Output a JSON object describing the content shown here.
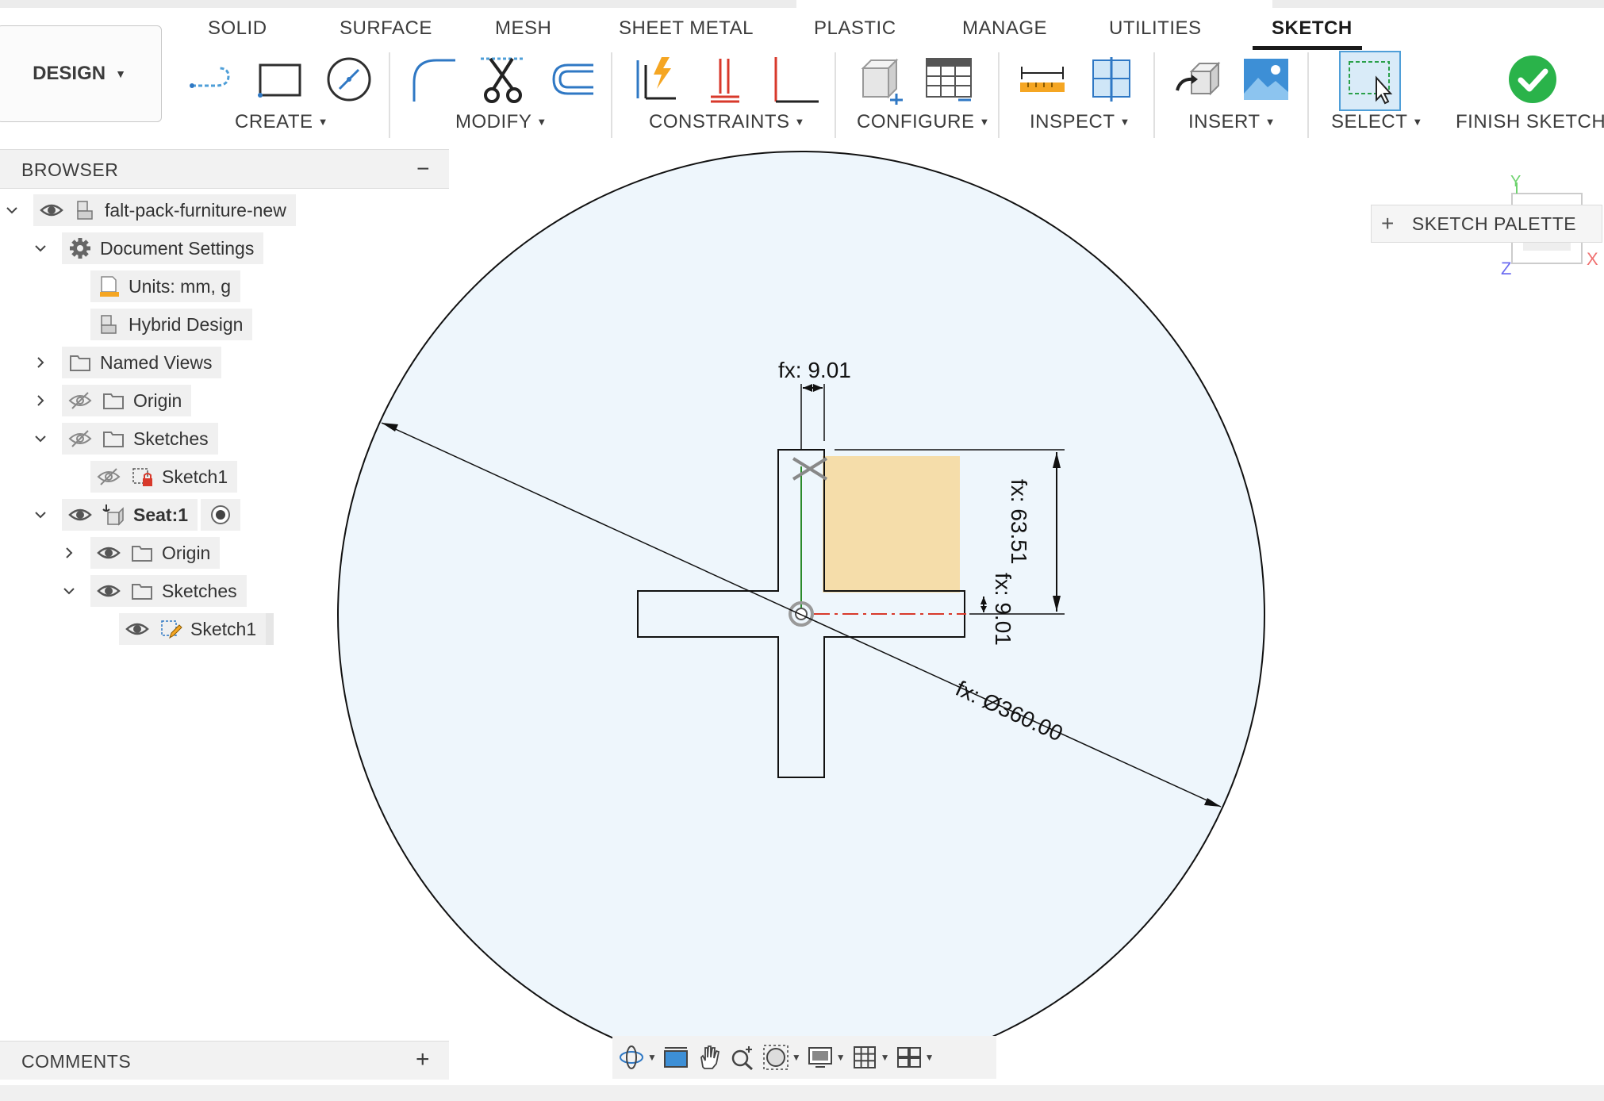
{
  "tabs": [
    "SOLID",
    "SURFACE",
    "MESH",
    "SHEET METAL",
    "PLASTIC",
    "MANAGE",
    "UTILITIES",
    "SKETCH"
  ],
  "active_tab": "SKETCH",
  "workspace": {
    "label": "DESIGN"
  },
  "groups": {
    "create": "CREATE",
    "modify": "MODIFY",
    "constraints": "CONSTRAINTS",
    "configure": "CONFIGURE",
    "inspect": "INSPECT",
    "insert": "INSERT",
    "select": "SELECT",
    "finish": "FINISH SKETCH"
  },
  "browser": {
    "title": "BROWSER",
    "collapse_symbol": "−",
    "items": [
      {
        "label": "falt-pack-furniture-new",
        "icon": "component-icon"
      },
      {
        "label": "Document Settings",
        "icon": "gear-icon"
      },
      {
        "label": "Units: mm, g",
        "icon": "ruler-doc-icon"
      },
      {
        "label": "Hybrid Design",
        "icon": "component-icon"
      },
      {
        "label": "Named Views",
        "icon": "folder-icon"
      },
      {
        "label": "Origin",
        "icon": "folder-icon"
      },
      {
        "label": "Sketches",
        "icon": "folder-icon"
      },
      {
        "label": "Sketch1",
        "icon": "sketch-locked-icon"
      },
      {
        "label": "Seat:1",
        "icon": "anchored-component-icon"
      },
      {
        "label": "Origin",
        "icon": "folder-icon"
      },
      {
        "label": "Sketches",
        "icon": "folder-icon"
      },
      {
        "label": "Sketch1",
        "icon": "sketch-edit-icon"
      }
    ]
  },
  "comments": {
    "title": "COMMENTS",
    "add_symbol": "+"
  },
  "sketch_palette": {
    "label": "SKETCH PALETTE",
    "add_symbol": "+"
  },
  "dimensions": {
    "top_width": "fx: 9.01",
    "vertical_height": "fx: 63.51",
    "right_width": "fx: 9.01",
    "diameter": "fx: Ø360.00"
  },
  "view_cube": {
    "x": "X",
    "y": "Y",
    "z": "Z"
  },
  "colors": {
    "disc_fill": "#eef6fc",
    "profile_fill": "#f5ddaa",
    "finish_green": "#2ab34a",
    "construction_red": "#d8392b",
    "select_blue": "#4f9fd8"
  }
}
